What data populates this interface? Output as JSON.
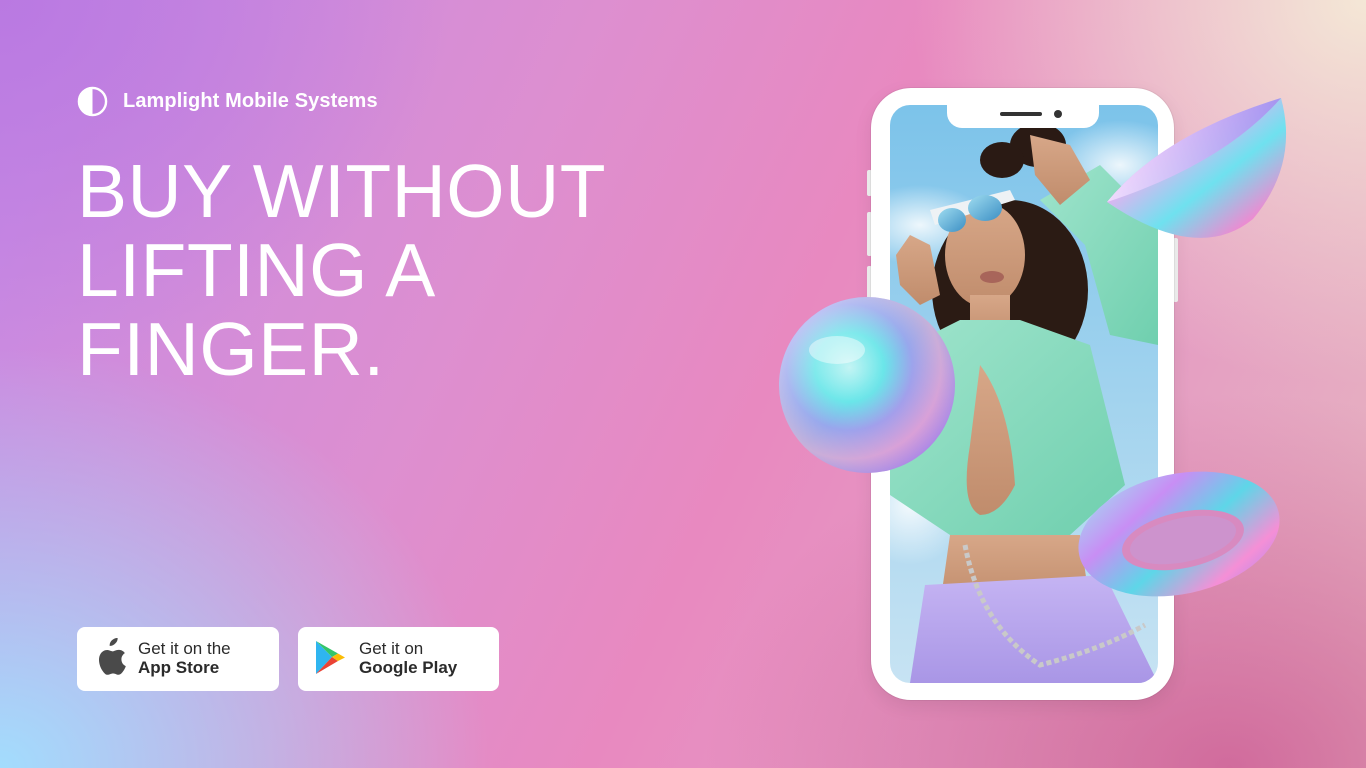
{
  "brand": {
    "name": "Lamplight Mobile Systems",
    "icon": "half-circle-logo-icon"
  },
  "hero": {
    "headline_lines": [
      "BUY WITHOUT",
      "LIFTING A",
      "FINGER."
    ]
  },
  "store_buttons": {
    "app_store": {
      "line1": "Get it on the",
      "line2": "App Store",
      "icon": "apple-icon"
    },
    "google_play": {
      "line1": "Get it on",
      "line2": "Google Play",
      "icon": "google-play-icon"
    }
  },
  "colors": {
    "text_primary": "#ffffff",
    "button_bg": "#ffffff",
    "button_text": "#2b2b2b",
    "mint_top": "#8fdcc2",
    "lavender_pants": "#b9a6ef"
  }
}
